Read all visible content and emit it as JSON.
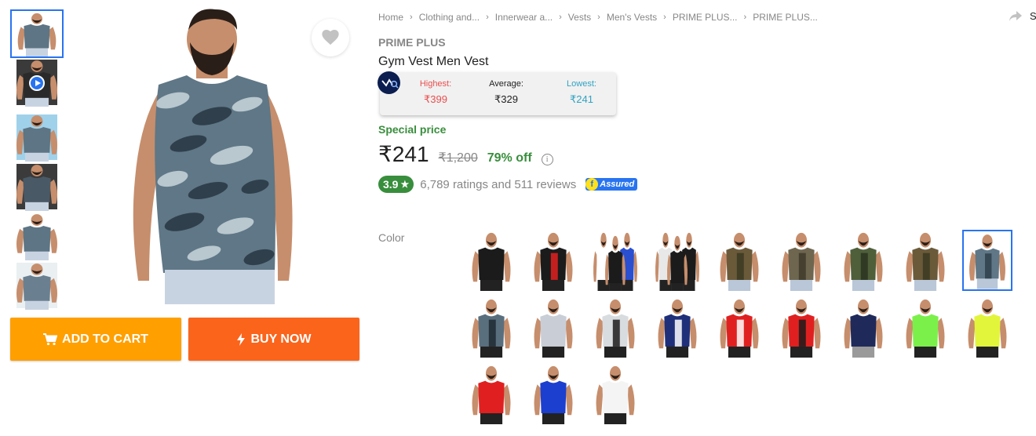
{
  "thumbnails": [
    {
      "kind": "image",
      "shirt_color": "#5d7584",
      "bg": "#ffffff",
      "selected": true
    },
    {
      "kind": "video",
      "shirt_color": "#2a2a2a",
      "bg": "#3a3a3a",
      "selected": false
    },
    {
      "kind": "image",
      "shirt_color": "#5d7584",
      "bg": "#9fd1ea",
      "selected": false
    },
    {
      "kind": "image",
      "shirt_color": "#4a5966",
      "bg": "#3b3b3b",
      "selected": false
    },
    {
      "kind": "image",
      "shirt_color": "#5d7584",
      "bg": "#ffffff",
      "selected": false
    },
    {
      "kind": "image",
      "shirt_color": "#6a8090",
      "bg": "#eaf0f2",
      "selected": false
    }
  ],
  "main_image": {
    "shirt_color": "#5f7786",
    "camo_light": "#b9c7cf",
    "camo_dark": "#2f3f4b",
    "shorts_color": "#c8d3e2",
    "skin": "#c68e6c",
    "beard": "#2a1e18"
  },
  "actions": {
    "add_to_cart": "ADD TO CART",
    "buy_now": "BUY NOW"
  },
  "breadcrumbs": [
    "Home",
    "Clothing and...",
    "Innerwear a...",
    "Vests",
    "Men's Vests",
    "PRIME PLUS...",
    "PRIME PLUS..."
  ],
  "share_label": "S",
  "product": {
    "brand": "PRIME PLUS",
    "title": "Gym Vest Men Vest"
  },
  "price_history": {
    "highest_label": "Highest:",
    "highest_value": "₹399",
    "average_label": "Average:",
    "average_value": "₹329",
    "lowest_label": "Lowest:",
    "lowest_value": "₹241"
  },
  "pricing": {
    "special_label": "Special price",
    "current": "₹241",
    "mrp": "₹1,200",
    "discount": "79% off",
    "info_glyph": "i"
  },
  "rating": {
    "score": "3.9",
    "star": "★",
    "summary": "6,789 ratings and 511 reviews",
    "assured_badge": "Assured",
    "assured_f": "f"
  },
  "color_label": "Color",
  "colors": {
    "brand_blue": "#2874f0",
    "cart_orange": "#ff9f00",
    "buy_orange": "#fb641b",
    "green": "#388e3c"
  },
  "swatches": [
    {
      "main": "#1b1b1b",
      "accent": "#1b1b1b",
      "shorts": "#222222",
      "count": 1,
      "selected": false
    },
    {
      "main": "#1b1b1b",
      "accent": "#e02020",
      "shorts": "#222222",
      "count": 1,
      "selected": false
    },
    {
      "main": "#2a4fd0",
      "accent": "#ffffff",
      "shorts": "#222222",
      "count": 3,
      "selected": false
    },
    {
      "main": "#1b1b1b",
      "accent": "#e8e8e8",
      "shorts": "#222222",
      "count": 3,
      "selected": false
    },
    {
      "main": "#6b5a3a",
      "accent": "#3a3a22",
      "shorts": "#b9c7d8",
      "count": 1,
      "selected": false
    },
    {
      "main": "#6f6650",
      "accent": "#3f3a2a",
      "shorts": "#b9c7d8",
      "count": 1,
      "selected": false
    },
    {
      "main": "#4f5f3a",
      "accent": "#2a3320",
      "shorts": "#b9c7d8",
      "count": 1,
      "selected": false
    },
    {
      "main": "#6b5a3a",
      "accent": "#3a3a22",
      "shorts": "#b9c7d8",
      "count": 1,
      "selected": false
    },
    {
      "main": "#5f7786",
      "accent": "#2f3f4b",
      "shorts": "#b9c7d8",
      "count": 1,
      "selected": true
    },
    {
      "main": "#5a6f7e",
      "accent": "#1e2a33",
      "shorts": "#222222",
      "count": 1,
      "selected": false
    },
    {
      "main": "#c9ced6",
      "accent": "#c9ced6",
      "shorts": "#222222",
      "count": 1,
      "selected": false
    },
    {
      "main": "#d9dcdf",
      "accent": "#1b1b1b",
      "shorts": "#222222",
      "count": 1,
      "selected": false
    },
    {
      "main": "#1f2f7a",
      "accent": "#ffffff",
      "shorts": "#222222",
      "count": 1,
      "selected": false
    },
    {
      "main": "#e02020",
      "accent": "#ffffff",
      "shorts": "#222222",
      "count": 1,
      "selected": false
    },
    {
      "main": "#e02020",
      "accent": "#1b1b1b",
      "shorts": "#222222",
      "count": 1,
      "selected": false
    },
    {
      "main": "#1f2a5a",
      "accent": "#1f2a5a",
      "shorts": "#9a9a9a",
      "count": 1,
      "selected": false
    },
    {
      "main": "#7cf04a",
      "accent": "#7cf04a",
      "shorts": "#222222",
      "count": 1,
      "selected": false
    },
    {
      "main": "#e3f53a",
      "accent": "#e3f53a",
      "shorts": "#222222",
      "count": 1,
      "selected": false
    },
    {
      "main": "#e02020",
      "accent": "#e02020",
      "shorts": "#222222",
      "count": 1,
      "selected": false
    },
    {
      "main": "#1c3fd0",
      "accent": "#1c3fd0",
      "shorts": "#222222",
      "count": 1,
      "selected": false
    },
    {
      "main": "#f4f4f4",
      "accent": "#f4f4f4",
      "shorts": "#222222",
      "count": 1,
      "selected": false
    }
  ]
}
